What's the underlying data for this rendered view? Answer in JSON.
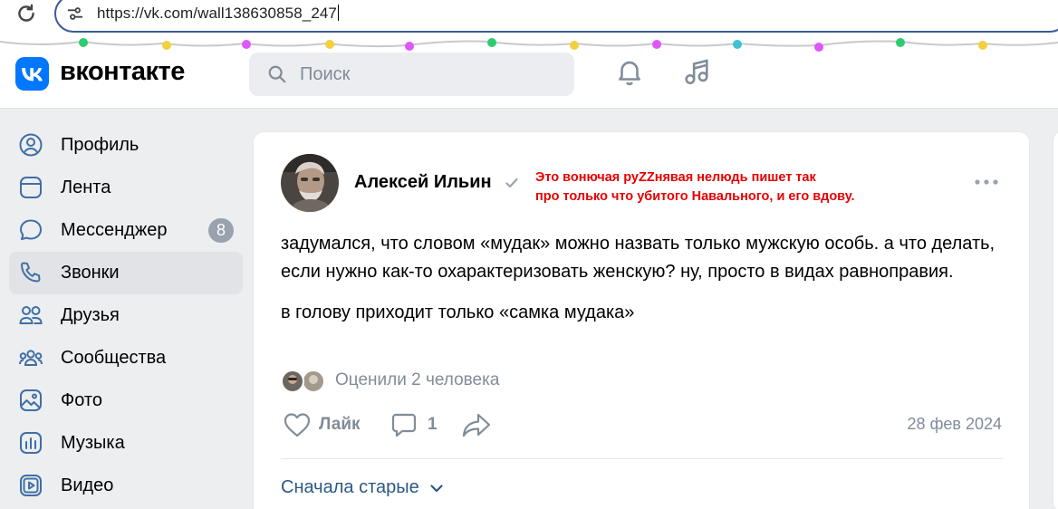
{
  "browser": {
    "url": "https://vk.com/wall138630858_247"
  },
  "header": {
    "logo_text": "вконтакте",
    "search_placeholder": "Поиск",
    "brand_color": "#0077ff"
  },
  "sidebar": {
    "items": [
      {
        "label": "Профиль",
        "icon": "profile-icon"
      },
      {
        "label": "Лента",
        "icon": "feed-icon"
      },
      {
        "label": "Мессенджер",
        "icon": "messenger-icon",
        "badge": "8"
      },
      {
        "label": "Звонки",
        "icon": "phone-icon",
        "active": true
      },
      {
        "label": "Друзья",
        "icon": "friends-icon"
      },
      {
        "label": "Сообщества",
        "icon": "communities-icon"
      },
      {
        "label": "Фото",
        "icon": "photo-icon"
      },
      {
        "label": "Музыка",
        "icon": "music-icon"
      },
      {
        "label": "Видео",
        "icon": "video-icon"
      }
    ]
  },
  "post": {
    "author": "Алексей Ильин",
    "annotation_line1": "Это вонючая руZZнявая нелюдь пишет так",
    "annotation_line2": "про только что убитого Навального, и его вдову.",
    "paragraph1": "задумался, что словом «мудак» можно назвать только мужскую особь. а что делать, если нужно как-то охарактеризовать женскую? ну, просто в видах равноправия.",
    "paragraph2": "в голову приходит только «самка мудака»",
    "likers_text": "Оценили 2 человека",
    "like_label": "Лайк",
    "comment_count": "1",
    "date": "28 фев 2024",
    "sort_label": "Сначала старые",
    "annotation_color": "#e60000"
  }
}
